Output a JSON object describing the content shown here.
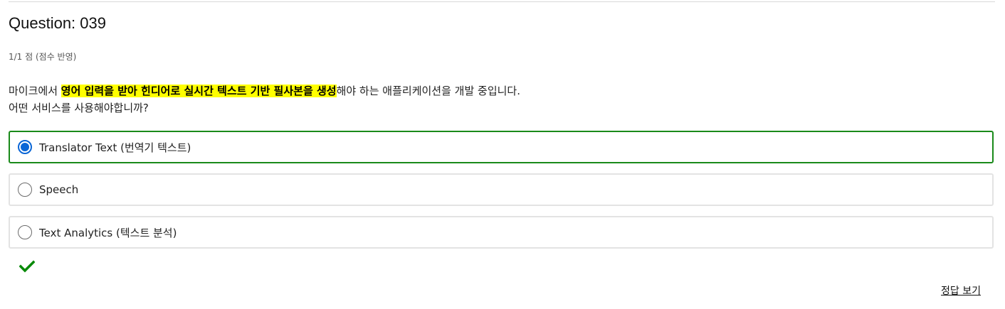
{
  "question": {
    "title": "Question: 039",
    "score": "1/1 점 (점수 반영)",
    "prompt_before": "마이크에서 ",
    "prompt_highlight": "영어 입력을 받아 힌디어로 실시간 텍스트 기반 필사본을 생성",
    "prompt_after": "해야 하는 애플리케이션을 개발 중입니다.",
    "prompt_line2": "어떤 서비스를 사용해야합니까?"
  },
  "options": [
    {
      "label": "Translator Text (번역기 텍스트)",
      "selected": true
    },
    {
      "label": "Speech",
      "selected": false
    },
    {
      "label": "Text Analytics (텍스트 분석)",
      "selected": false
    }
  ],
  "result": {
    "icon": "checkmark-icon",
    "color": "#0a8a0a"
  },
  "show_answer_label": "정답 보기",
  "colors": {
    "selected_border": "#1a8a1a",
    "radio_selected": "#0a66d6",
    "highlight": "#ffff00"
  }
}
